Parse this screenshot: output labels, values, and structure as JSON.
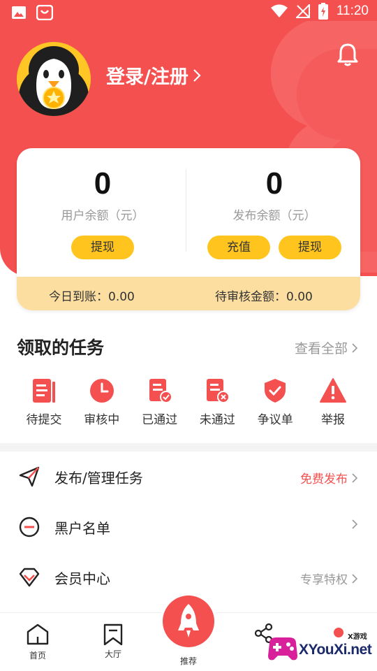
{
  "status_bar": {
    "time": "11:20"
  },
  "header": {
    "login_label": "登录/注册",
    "background_color": "#f4504f"
  },
  "balances": {
    "user": {
      "value": "0",
      "label": "用户余额（元）",
      "buttons": [
        "提现"
      ]
    },
    "publish": {
      "value": "0",
      "label": "发布余额（元）",
      "buttons": [
        "充值",
        "提现"
      ]
    },
    "today_label": "今日到账：0.00",
    "pending_label": "待审核金额：0.00"
  },
  "tasks_section": {
    "title": "领取的任务",
    "see_all": "查看全部",
    "items": [
      {
        "label": "待提交",
        "icon": "document-icon"
      },
      {
        "label": "审核中",
        "icon": "clock-icon"
      },
      {
        "label": "已通过",
        "icon": "doc-check-icon"
      },
      {
        "label": "未通过",
        "icon": "doc-cross-icon"
      },
      {
        "label": "争议单",
        "icon": "shield-check-icon"
      },
      {
        "label": "举报",
        "icon": "warning-icon"
      }
    ]
  },
  "menu": [
    {
      "label": "发布/管理任务",
      "extra": "免费发布",
      "icon": "paper-plane-icon"
    },
    {
      "label": "黑户名单",
      "extra": "",
      "icon": "minus-circle-icon"
    },
    {
      "label": "会员中心",
      "extra": "专享特权",
      "icon": "diamond-icon"
    }
  ],
  "tabs": [
    {
      "label": "首页",
      "icon": "home-icon"
    },
    {
      "label": "大厅",
      "icon": "bookmark-icon"
    },
    {
      "label": "推荐",
      "icon": "rocket-icon"
    },
    {
      "label": "",
      "icon": "share-icon"
    }
  ],
  "watermark": {
    "text": "XYouXi.net",
    "small": "X游戏"
  },
  "colors": {
    "accent": "#f4504f",
    "button_yellow": "#ffc51e",
    "strip": "#fbdea0",
    "free_publish": "#f4504f"
  }
}
